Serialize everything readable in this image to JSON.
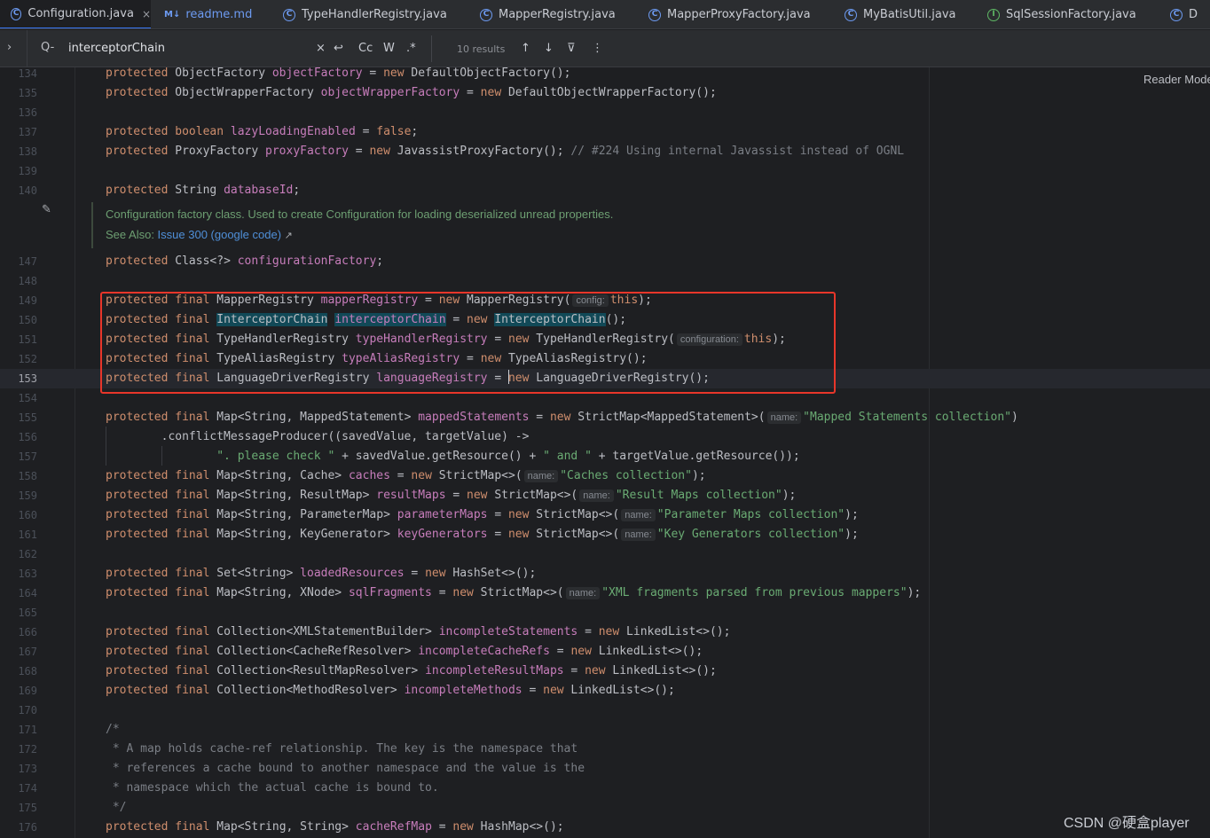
{
  "tabs": [
    {
      "label": "Configuration.java",
      "icon": "C",
      "close": "×"
    },
    {
      "label": "readme.md",
      "icon": "M↓"
    },
    {
      "label": "TypeHandlerRegistry.java",
      "icon": "C"
    },
    {
      "label": "MapperRegistry.java",
      "icon": "C"
    },
    {
      "label": "MapperProxyFactory.java",
      "icon": "C"
    },
    {
      "label": "MyBatisUtil.java",
      "icon": "C"
    },
    {
      "label": "SqlSessionFactory.java",
      "icon": "I"
    },
    {
      "label": "D",
      "icon": "C"
    }
  ],
  "search": {
    "query": "interceptorChain",
    "chevron": "›",
    "search_icon": "Q-",
    "clear": "×",
    "regex_toggle": "↩",
    "match_case": "Cc",
    "words": "W",
    "regex": ".*",
    "results": "10 results",
    "prev": "↑",
    "next": "↓",
    "filter": "⊽",
    "more": "⋮"
  },
  "reader_mode": "Reader Mode",
  "doc": {
    "line1": "Configuration factory class. Used to create Configuration for loading deserialized unread properties.",
    "see_also": "See Also: ",
    "link": "Issue 300 (google code)",
    "arrow": "↗"
  },
  "watermark": "CSDN @硬盒player",
  "colors": {
    "keyword": "#cf8e6d",
    "field": "#c77dbb",
    "string": "#6aab73",
    "comment": "#7a7e85",
    "highlight_box": "#e8362a",
    "search_hit": "#114957"
  },
  "lines": [
    {
      "n": "134"
    },
    {
      "n": "135"
    },
    {
      "n": "136"
    },
    {
      "n": "137"
    },
    {
      "n": "138"
    },
    {
      "n": "139"
    },
    {
      "n": "140"
    },
    {
      "n": "147"
    },
    {
      "n": "148"
    },
    {
      "n": "149"
    },
    {
      "n": "150"
    },
    {
      "n": "151"
    },
    {
      "n": "152"
    },
    {
      "n": "153"
    },
    {
      "n": "154"
    },
    {
      "n": "155"
    },
    {
      "n": "156"
    },
    {
      "n": "157"
    },
    {
      "n": "158"
    },
    {
      "n": "159"
    },
    {
      "n": "160"
    },
    {
      "n": "161"
    },
    {
      "n": "162"
    },
    {
      "n": "163"
    },
    {
      "n": "164"
    },
    {
      "n": "165"
    },
    {
      "n": "166"
    },
    {
      "n": "167"
    },
    {
      "n": "168"
    },
    {
      "n": "169"
    },
    {
      "n": "170"
    },
    {
      "n": "171"
    },
    {
      "n": "172"
    },
    {
      "n": "173"
    },
    {
      "n": "174"
    },
    {
      "n": "175"
    },
    {
      "n": "176"
    }
  ],
  "code": {
    "l134": [
      "protected",
      " ObjectFactory ",
      "objectFactory",
      " = ",
      "new",
      " DefaultObjectFactory();"
    ],
    "l135": [
      "protected",
      " ObjectWrapperFactory ",
      "objectWrapperFactory",
      " = ",
      "new",
      " DefaultObjectWrapperFactory();"
    ],
    "l137": [
      "protected",
      " ",
      "boolean",
      " ",
      "lazyLoadingEnabled",
      " = ",
      "false",
      ";"
    ],
    "l138": [
      "protected",
      " ProxyFactory ",
      "proxyFactory",
      " = ",
      "new",
      " JavassistProxyFactory(); ",
      "// #224 Using internal Javassist instead of OGNL"
    ],
    "l140": [
      "protected",
      " String ",
      "databaseId",
      ";"
    ],
    "l147": [
      "protected",
      " Class<?> ",
      "configurationFactory",
      ";"
    ],
    "l149": [
      "protected",
      " ",
      "final",
      " MapperRegistry ",
      "mapperRegistry",
      " = ",
      "new",
      " MapperRegistry(",
      "config:",
      "this",
      ");"
    ],
    "l150": [
      "protected",
      " ",
      "final",
      " ",
      "InterceptorChain",
      " ",
      "interceptorChain",
      " = ",
      "new",
      " ",
      "InterceptorChain",
      "();"
    ],
    "l151": [
      "protected",
      " ",
      "final",
      " TypeHandlerRegistry ",
      "typeHandlerRegistry",
      " = ",
      "new",
      " TypeHandlerRegistry(",
      "configuration:",
      "this",
      ");"
    ],
    "l152": [
      "protected",
      " ",
      "final",
      " TypeAliasRegistry ",
      "typeAliasRegistry",
      " = ",
      "new",
      " TypeAliasRegistry();"
    ],
    "l153": [
      "protected",
      " ",
      "final",
      " LanguageDriverRegistry ",
      "languageRegistry",
      " = ",
      "new",
      " LanguageDriverRegistry();"
    ],
    "l155": [
      "protected",
      " ",
      "final",
      " Map<String, MappedStatement> ",
      "mappedStatements",
      " = ",
      "new",
      " StrictMap<MappedStatement>(",
      "name:",
      "\"Mapped Statements collection\"",
      ")"
    ],
    "l156": [
      "        .conflictMessageProducer((savedValue, targetValue) ->"
    ],
    "l157": [
      "                ",
      "\". please check \"",
      " + savedValue.getResource() + ",
      "\" and \"",
      " + targetValue.getResource());"
    ],
    "l158": [
      "protected",
      " ",
      "final",
      " Map<String, Cache> ",
      "caches",
      " = ",
      "new",
      " StrictMap<>(",
      "name:",
      "\"Caches collection\"",
      ");"
    ],
    "l159": [
      "protected",
      " ",
      "final",
      " Map<String, ResultMap> ",
      "resultMaps",
      " = ",
      "new",
      " StrictMap<>(",
      "name:",
      "\"Result Maps collection\"",
      ");"
    ],
    "l160": [
      "protected",
      " ",
      "final",
      " Map<String, ParameterMap> ",
      "parameterMaps",
      " = ",
      "new",
      " StrictMap<>(",
      "name:",
      "\"Parameter Maps collection\"",
      ");"
    ],
    "l161": [
      "protected",
      " ",
      "final",
      " Map<String, KeyGenerator> ",
      "keyGenerators",
      " = ",
      "new",
      " StrictMap<>(",
      "name:",
      "\"Key Generators collection\"",
      ");"
    ],
    "l163": [
      "protected",
      " ",
      "final",
      " Set<String> ",
      "loadedResources",
      " = ",
      "new",
      " HashSet<>();"
    ],
    "l164": [
      "protected",
      " ",
      "final",
      " Map<String, XNode> ",
      "sqlFragments",
      " = ",
      "new",
      " StrictMap<>(",
      "name:",
      "\"XML fragments parsed from previous mappers\"",
      ");"
    ],
    "l166": [
      "protected",
      " ",
      "final",
      " Collection<XMLStatementBuilder> ",
      "incompleteStatements",
      " = ",
      "new",
      " LinkedList<>();"
    ],
    "l167": [
      "protected",
      " ",
      "final",
      " Collection<CacheRefResolver> ",
      "incompleteCacheRefs",
      " = ",
      "new",
      " LinkedList<>();"
    ],
    "l168": [
      "protected",
      " ",
      "final",
      " Collection<ResultMapResolver> ",
      "incompleteResultMaps",
      " = ",
      "new",
      " LinkedList<>();"
    ],
    "l169": [
      "protected",
      " ",
      "final",
      " Collection<MethodResolver> ",
      "incompleteMethods",
      " = ",
      "new",
      " LinkedList<>();"
    ],
    "l171": [
      "/*"
    ],
    "l172": [
      " * A map holds cache-ref relationship. The key is the namespace that"
    ],
    "l173": [
      " * references a cache bound to another namespace and the value is the"
    ],
    "l174": [
      " * namespace which the actual cache is bound to."
    ],
    "l175": [
      " */"
    ],
    "l176": [
      "protected",
      " ",
      "final",
      " Map<String, String> ",
      "cacheRefMap",
      " = ",
      "new",
      " HashMap<>();"
    ]
  }
}
